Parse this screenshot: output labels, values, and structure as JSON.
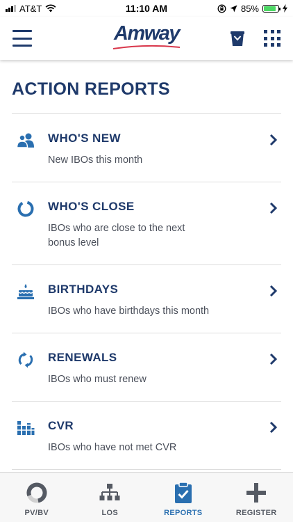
{
  "status_bar": {
    "carrier": "AT&T",
    "time": "11:10 AM",
    "battery": "85%",
    "signal_icon": "signal-icon",
    "wifi_icon": "wifi-icon",
    "battery_icon": "battery-icon"
  },
  "header": {
    "logo": "Amway",
    "menu_icon": "hamburger-icon",
    "bag_icon": "shopping-bag-icon",
    "apps_icon": "grid-icon"
  },
  "page": {
    "title": "ACTION REPORTS"
  },
  "reports": [
    {
      "title": "WHO'S NEW",
      "description": "New IBOs this month",
      "icon": "users-icon"
    },
    {
      "title": "WHO'S CLOSE",
      "description": "IBOs who are close to the next bonus level",
      "icon": "progress-ring-icon"
    },
    {
      "title": "BIRTHDAYS",
      "description": "IBOs who have birthdays this month",
      "icon": "birthday-cake-icon"
    },
    {
      "title": "RENEWALS",
      "description": "IBOs who must renew",
      "icon": "renew-icon"
    },
    {
      "title": "CVR",
      "description": "IBOs who have not met CVR",
      "icon": "cvr-chart-icon"
    }
  ],
  "tabs": [
    {
      "label": "PV/BV",
      "icon": "pvbv-ring-icon",
      "active": false
    },
    {
      "label": "LOS",
      "icon": "org-chart-icon",
      "active": false
    },
    {
      "label": "REPORTS",
      "icon": "clipboard-check-icon",
      "active": true
    },
    {
      "label": "REGISTER",
      "icon": "plus-icon",
      "active": false
    }
  ],
  "colors": {
    "brand_navy": "#1f3a6b",
    "accent_blue": "#2a6fb0",
    "logo_swoosh": "#d9374b",
    "battery_green": "#4cd964"
  }
}
